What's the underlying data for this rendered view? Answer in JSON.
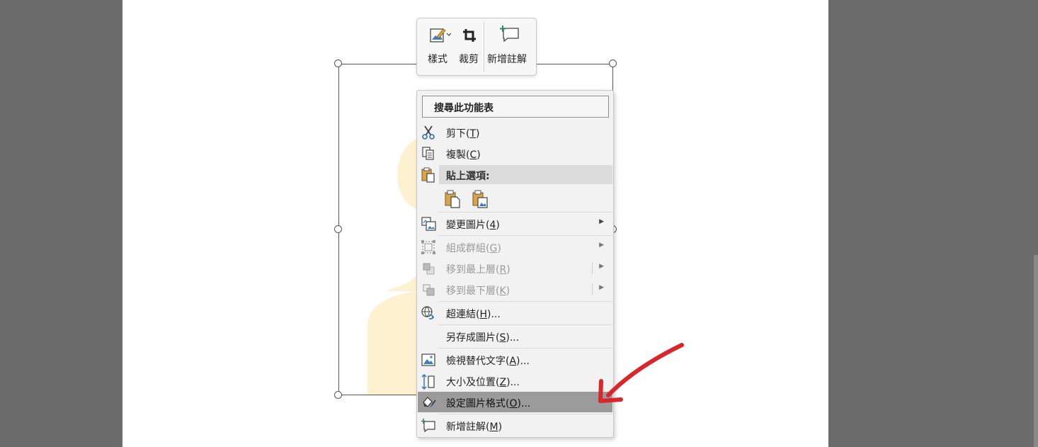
{
  "mini_toolbar": {
    "style_label": "樣式",
    "crop_label": "裁剪",
    "new_comment_label": "新增註解"
  },
  "context_menu": {
    "search_placeholder": "搜尋此功能表",
    "cut": {
      "label": "剪下",
      "key": "T"
    },
    "copy": {
      "label": "複製",
      "key": "C"
    },
    "paste_options_label": "貼上選項:",
    "change_picture": {
      "label": "變更圖片",
      "key": "4"
    },
    "group": {
      "label": "組成群組",
      "key": "G"
    },
    "bring_to_front": {
      "label": "移到最上層",
      "key": "R"
    },
    "send_to_back": {
      "label": "移到最下層",
      "key": "K"
    },
    "hyperlink": {
      "label": "超連結",
      "key": "H",
      "suffix": "..."
    },
    "save_as_picture": {
      "label": "另存成圖片",
      "key": "S",
      "suffix": "..."
    },
    "alt_text": {
      "label": "檢視替代文字",
      "key": "A",
      "suffix": "..."
    },
    "size_position": {
      "label": "大小及位置",
      "key": "Z",
      "suffix": "..."
    },
    "format_picture": {
      "label": "設定圖片格式",
      "key": "O",
      "suffix": "..."
    },
    "new_comment": {
      "label": "新增註解",
      "key": "M"
    }
  },
  "colors": {
    "annotation_arrow": "#d9262b",
    "highlight": "#9b9b9b",
    "silhouette": "#fdf1cf"
  }
}
